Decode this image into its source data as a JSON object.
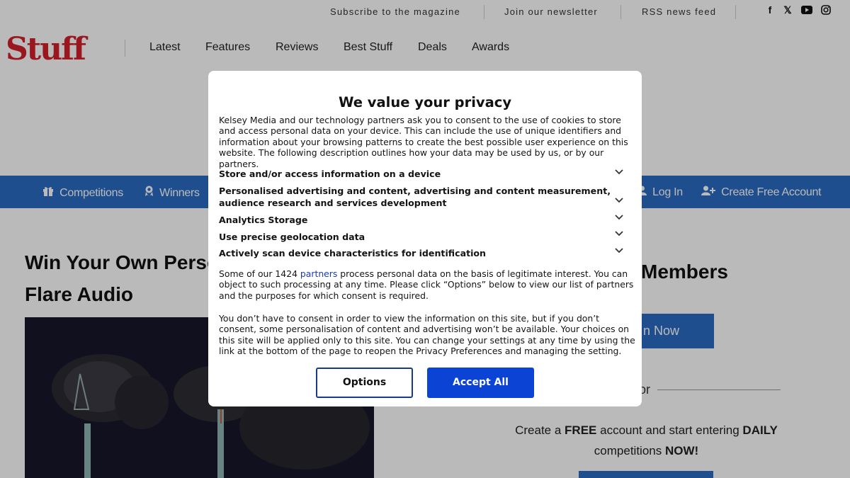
{
  "util_bar": {
    "links": [
      "Subscribe to the magazine",
      "Join our newsletter",
      "RSS news feed"
    ],
    "social_icons": [
      "facebook-icon",
      "x-icon",
      "youtube-icon",
      "instagram-icon"
    ]
  },
  "header": {
    "logo_text": "Stuff",
    "nav": [
      "Latest",
      "Features",
      "Reviews",
      "Best Stuff",
      "Deals",
      "Awards"
    ]
  },
  "blue_nav": {
    "competitions": "Competitions",
    "winners": "Winners",
    "login": "Log In",
    "create_account": "Create Free Account"
  },
  "article": {
    "title_line1": "Win Your Own Perso",
    "title_line2": "Flare Audio"
  },
  "sidebar": {
    "heading_partial": "Members",
    "join_partial": "n Now",
    "or_text": "or",
    "promo_1": "Create a ",
    "promo_free": "FREE",
    "promo_2": " account and start entering ",
    "promo_daily": "DAILY",
    "promo_3": "competitions ",
    "promo_now": "NOW!"
  },
  "consent": {
    "title": "We value your privacy",
    "intro": "Kelsey Media and our technology partners ask you to consent to the use of cookies to store and access personal data on your device. This can include the use of unique identifiers and information about your browsing patterns to create the best possible user experience on this website. The following description outlines how your data may be used by us, or by our partners.",
    "purposes": [
      "Store and/or access information on a device",
      "Personalised advertising and content, advertising and content measurement, audience research and services development",
      "Analytics Storage",
      "Use precise geolocation data",
      "Actively scan device characteristics for identification"
    ],
    "legit_1": "Some of our 1424 ",
    "legit_link": "partners",
    "legit_2": " process personal data on the basis of legitimate interest. You can object to such processing at any time. Please click “Options” below to view our list of partners and the purposes for which consent is required.",
    "no_consent": "You don’t have to consent in order to view the information on this site, but if you don’t consent, some personalisation of content and advertising won’t be available. Your choices on this site will be applied only to this site. You can change your settings at any time by using the link at the bottom of the page to reopen the Privacy Preferences and managing the setting.",
    "options_label": "Options",
    "accept_label": "Accept All"
  },
  "colors": {
    "brand_red": "#d4202b",
    "nav_blue": "#2b6cc4",
    "accept_blue": "#0b43d4",
    "options_border": "#173a8b",
    "link_blue": "#1a3bb8"
  }
}
